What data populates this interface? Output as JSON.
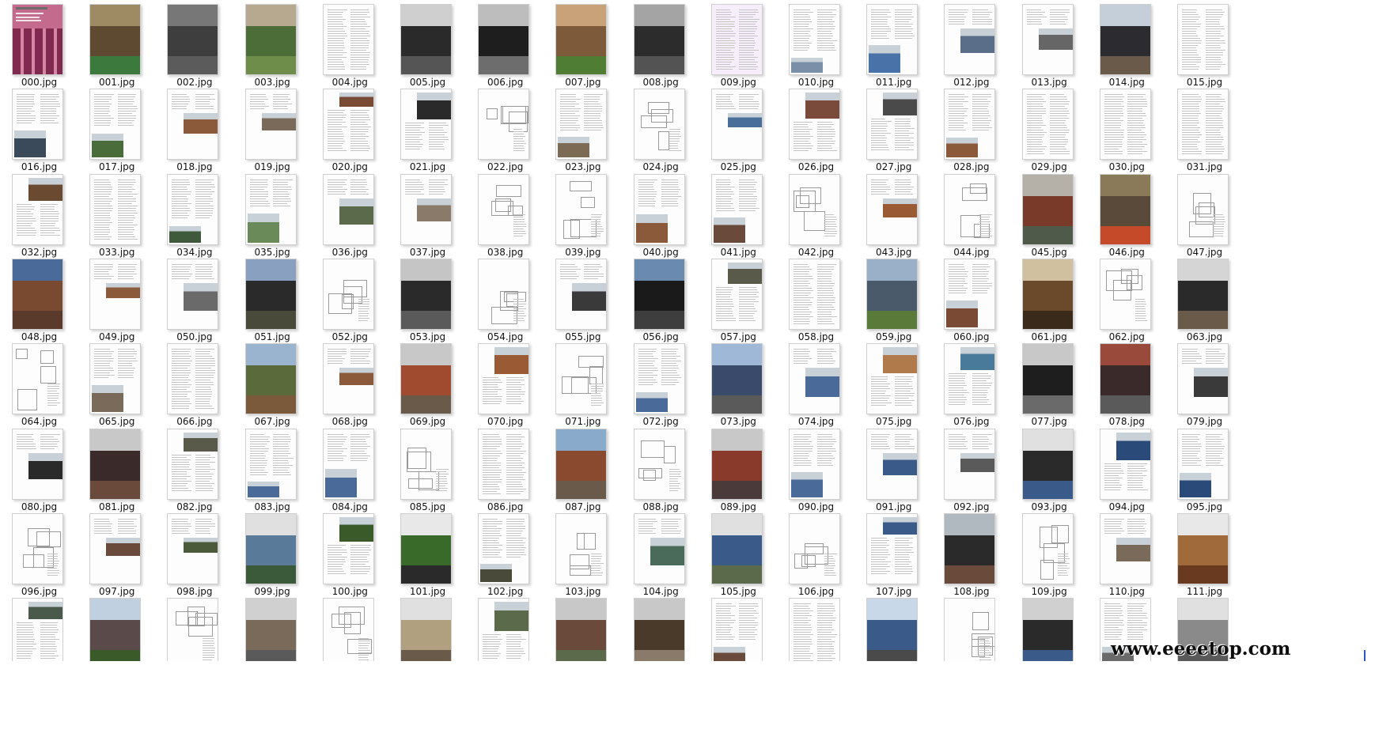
{
  "window": {
    "view": "large-icons",
    "watermark": "www.eeeetop.com"
  },
  "files": [
    {
      "name": "000.jpg",
      "kind": "cover"
    },
    {
      "name": "001.jpg",
      "kind": "photo",
      "colors": [
        "#5d4a30",
        "#9e8a63",
        "#3b7a3c"
      ]
    },
    {
      "name": "002.jpg",
      "kind": "photo",
      "colors": [
        "#3e3e3e",
        "#777777",
        "#5b5b5b"
      ]
    },
    {
      "name": "003.jpg",
      "kind": "photo",
      "colors": [
        "#4d6d38",
        "#b7a890",
        "#6e8c4a"
      ]
    },
    {
      "name": "004.jpg",
      "kind": "text"
    },
    {
      "name": "005.jpg",
      "kind": "photo",
      "colors": [
        "#2a2a2a",
        "#cfcfcf",
        "#555555"
      ]
    },
    {
      "name": "006.jpg",
      "kind": "photo",
      "colors": [
        "#1e1e1e",
        "#bdbdbd",
        "#6d6d6d"
      ]
    },
    {
      "name": "007.jpg",
      "kind": "photo",
      "colors": [
        "#7d5a3a",
        "#caa27a",
        "#4f7d34"
      ]
    },
    {
      "name": "008.jpg",
      "kind": "photo",
      "colors": [
        "#2c2c2c",
        "#a4a4a4",
        "#535353"
      ]
    },
    {
      "name": "009.jpg",
      "kind": "text",
      "tint": "#f6eefb"
    },
    {
      "name": "010.jpg",
      "kind": "mixed",
      "colors": [
        "#7b8fa8"
      ]
    },
    {
      "name": "011.jpg",
      "kind": "mixed",
      "colors": [
        "#4872a8"
      ]
    },
    {
      "name": "012.jpg",
      "kind": "mixed",
      "colors": [
        "#5a6e8a"
      ]
    },
    {
      "name": "013.jpg",
      "kind": "mixed",
      "colors": [
        "#666666"
      ]
    },
    {
      "name": "014.jpg",
      "kind": "photo",
      "colors": [
        "#2c2c30",
        "#c5cfd9",
        "#6a5a4a"
      ]
    },
    {
      "name": "015.jpg",
      "kind": "text"
    },
    {
      "name": "016.jpg",
      "kind": "mixed",
      "colors": [
        "#3b4a5a"
      ]
    },
    {
      "name": "017.jpg",
      "kind": "mixed",
      "colors": [
        "#4a6c3a"
      ]
    },
    {
      "name": "018.jpg",
      "kind": "mixed",
      "colors": [
        "#8a5a3a"
      ]
    },
    {
      "name": "019.jpg",
      "kind": "mixed",
      "colors": [
        "#7a6a5a"
      ]
    },
    {
      "name": "020.jpg",
      "kind": "mixed",
      "colors": [
        "#7a4a34"
      ]
    },
    {
      "name": "021.jpg",
      "kind": "mixed",
      "colors": [
        "#2a2a2a"
      ]
    },
    {
      "name": "022.jpg",
      "kind": "drawing"
    },
    {
      "name": "023.jpg",
      "kind": "mixed",
      "colors": [
        "#7d6a54"
      ]
    },
    {
      "name": "024.jpg",
      "kind": "drawing"
    },
    {
      "name": "025.jpg",
      "kind": "mixed",
      "colors": [
        "#4a6e9a"
      ]
    },
    {
      "name": "026.jpg",
      "kind": "mixed",
      "colors": [
        "#7a4a3a"
      ]
    },
    {
      "name": "027.jpg",
      "kind": "mixed",
      "colors": [
        "#4a4a4a"
      ]
    },
    {
      "name": "028.jpg",
      "kind": "mixed",
      "colors": [
        "#8a5a3a"
      ]
    },
    {
      "name": "029.jpg",
      "kind": "text"
    },
    {
      "name": "030.jpg",
      "kind": "text"
    },
    {
      "name": "031.jpg",
      "kind": "text"
    },
    {
      "name": "032.jpg",
      "kind": "mixed",
      "colors": [
        "#6a4a30"
      ]
    },
    {
      "name": "033.jpg",
      "kind": "text"
    },
    {
      "name": "034.jpg",
      "kind": "mixed",
      "colors": [
        "#3e5a3a"
      ]
    },
    {
      "name": "035.jpg",
      "kind": "mixed",
      "colors": [
        "#6a8a5a"
      ]
    },
    {
      "name": "036.jpg",
      "kind": "mixed",
      "colors": [
        "#5a6a4a"
      ]
    },
    {
      "name": "037.jpg",
      "kind": "mixed",
      "colors": [
        "#8a7a6a"
      ]
    },
    {
      "name": "038.jpg",
      "kind": "drawing"
    },
    {
      "name": "039.jpg",
      "kind": "drawing"
    },
    {
      "name": "040.jpg",
      "kind": "mixed",
      "colors": [
        "#8a5a3a"
      ]
    },
    {
      "name": "041.jpg",
      "kind": "mixed",
      "colors": [
        "#6a4a3a"
      ]
    },
    {
      "name": "042.jpg",
      "kind": "drawing"
    },
    {
      "name": "043.jpg",
      "kind": "mixed",
      "colors": [
        "#9a5a34"
      ]
    },
    {
      "name": "044.jpg",
      "kind": "drawing"
    },
    {
      "name": "045.jpg",
      "kind": "photo",
      "colors": [
        "#7a3a2a",
        "#b5b0a8",
        "#505a4a"
      ]
    },
    {
      "name": "046.jpg",
      "kind": "photo",
      "colors": [
        "#5a4a3a",
        "#8a7a5a",
        "#c44a2a"
      ]
    },
    {
      "name": "047.jpg",
      "kind": "drawing"
    },
    {
      "name": "048.jpg",
      "kind": "photo",
      "colors": [
        "#7a4a30",
        "#4a6a9a",
        "#5a3a2a"
      ]
    },
    {
      "name": "049.jpg",
      "kind": "mixed",
      "colors": [
        "#8a5a3a"
      ]
    },
    {
      "name": "050.jpg",
      "kind": "mixed",
      "colors": [
        "#6a6a6a"
      ]
    },
    {
      "name": "051.jpg",
      "kind": "photo",
      "colors": [
        "#2a2a2a",
        "#8aa0c0",
        "#4a4a3a"
      ]
    },
    {
      "name": "052.jpg",
      "kind": "drawing"
    },
    {
      "name": "053.jpg",
      "kind": "photo",
      "colors": [
        "#2a2a2a",
        "#c5c5c5",
        "#5a5a5a"
      ]
    },
    {
      "name": "054.jpg",
      "kind": "drawing"
    },
    {
      "name": "055.jpg",
      "kind": "mixed",
      "colors": [
        "#3a3a3a"
      ]
    },
    {
      "name": "056.jpg",
      "kind": "photo",
      "colors": [
        "#1a1a1a",
        "#6a8ab0",
        "#3e3e3e"
      ]
    },
    {
      "name": "057.jpg",
      "kind": "mixed",
      "colors": [
        "#5a5a4a"
      ]
    },
    {
      "name": "058.jpg",
      "kind": "text"
    },
    {
      "name": "059.jpg",
      "kind": "photo",
      "colors": [
        "#4a5a6a",
        "#9ab0c8",
        "#5a7a3a"
      ]
    },
    {
      "name": "060.jpg",
      "kind": "mixed",
      "colors": [
        "#7a4a34"
      ]
    },
    {
      "name": "061.jpg",
      "kind": "photo",
      "colors": [
        "#6a4a2a",
        "#d0c0a0",
        "#3a2a1a"
      ]
    },
    {
      "name": "062.jpg",
      "kind": "drawing"
    },
    {
      "name": "063.jpg",
      "kind": "photo",
      "colors": [
        "#2a2a2a",
        "#d5d5d5",
        "#6a5a4a"
      ]
    },
    {
      "name": "064.jpg",
      "kind": "drawing"
    },
    {
      "name": "065.jpg",
      "kind": "mixed",
      "colors": [
        "#7a6a5a"
      ]
    },
    {
      "name": "066.jpg",
      "kind": "text"
    },
    {
      "name": "067.jpg",
      "kind": "photo",
      "colors": [
        "#5a6a3a",
        "#9ab4d0",
        "#7a5a3a"
      ]
    },
    {
      "name": "068.jpg",
      "kind": "mixed",
      "colors": [
        "#8a5a3a"
      ]
    },
    {
      "name": "069.jpg",
      "kind": "photo",
      "colors": [
        "#a04a30",
        "#c8c8c8",
        "#6a5a4a"
      ]
    },
    {
      "name": "070.jpg",
      "kind": "mixed",
      "colors": [
        "#9a5a34"
      ]
    },
    {
      "name": "071.jpg",
      "kind": "drawing"
    },
    {
      "name": "072.jpg",
      "kind": "mixed",
      "colors": [
        "#4a6a9a"
      ]
    },
    {
      "name": "073.jpg",
      "kind": "photo",
      "colors": [
        "#3a4a6a",
        "#a0b8d8",
        "#5a5a5a"
      ]
    },
    {
      "name": "074.jpg",
      "kind": "mixed",
      "colors": [
        "#4a6a9a"
      ]
    },
    {
      "name": "075.jpg",
      "kind": "mixed",
      "colors": [
        "#b07a4a"
      ]
    },
    {
      "name": "076.jpg",
      "kind": "mixed",
      "colors": [
        "#4a7a9a"
      ]
    },
    {
      "name": "077.jpg",
      "kind": "photo",
      "colors": [
        "#1e1e1e",
        "#c8c8c8",
        "#6a6a6a"
      ]
    },
    {
      "name": "078.jpg",
      "kind": "photo",
      "colors": [
        "#3a2a2a",
        "#9a4a3a",
        "#5a5a5a"
      ]
    },
    {
      "name": "079.jpg",
      "kind": "mixed",
      "colors": [
        "#3a3a3a"
      ]
    },
    {
      "name": "080.jpg",
      "kind": "mixed",
      "colors": [
        "#2a2a2a"
      ]
    },
    {
      "name": "081.jpg",
      "kind": "photo",
      "colors": [
        "#3a2a2a",
        "#c8c8c8",
        "#6a4a3a"
      ]
    },
    {
      "name": "082.jpg",
      "kind": "mixed",
      "colors": [
        "#5a5a4a"
      ]
    },
    {
      "name": "083.jpg",
      "kind": "mixed",
      "colors": [
        "#4a6a9a"
      ]
    },
    {
      "name": "084.jpg",
      "kind": "mixed",
      "colors": [
        "#4a6a9a"
      ]
    },
    {
      "name": "085.jpg",
      "kind": "drawing"
    },
    {
      "name": "086.jpg",
      "kind": "text"
    },
    {
      "name": "087.jpg",
      "kind": "photo",
      "colors": [
        "#8a4a30",
        "#8aaacc",
        "#6a5a4a"
      ]
    },
    {
      "name": "088.jpg",
      "kind": "drawing"
    },
    {
      "name": "089.jpg",
      "kind": "photo",
      "colors": [
        "#8a3a2a",
        "#c8c8c8",
        "#4a3a3a"
      ]
    },
    {
      "name": "090.jpg",
      "kind": "mixed",
      "colors": [
        "#4a6a9a"
      ]
    },
    {
      "name": "091.jpg",
      "kind": "mixed",
      "colors": [
        "#3a5a8a"
      ]
    },
    {
      "name": "092.jpg",
      "kind": "mixed",
      "colors": [
        "#5a5a5a"
      ]
    },
    {
      "name": "093.jpg",
      "kind": "photo",
      "colors": [
        "#2a2a2a",
        "#e0e0e0",
        "#3a5a8a"
      ]
    },
    {
      "name": "094.jpg",
      "kind": "mixed",
      "colors": [
        "#2a4a7a"
      ]
    },
    {
      "name": "095.jpg",
      "kind": "mixed",
      "colors": [
        "#2a4a7a"
      ]
    },
    {
      "name": "096.jpg",
      "kind": "drawing"
    },
    {
      "name": "097.jpg",
      "kind": "mixed",
      "colors": [
        "#6a4a3a"
      ]
    },
    {
      "name": "098.jpg",
      "kind": "mixed",
      "colors": [
        "#4a5a3a"
      ]
    },
    {
      "name": "099.jpg",
      "kind": "photo",
      "colors": [
        "#5a7a9a",
        "#e0e0e0",
        "#3a5a3a"
      ]
    },
    {
      "name": "100.jpg",
      "kind": "mixed",
      "colors": [
        "#3a5a2a"
      ]
    },
    {
      "name": "101.jpg",
      "kind": "photo",
      "colors": [
        "#3a6a2a",
        "#e8e8e8",
        "#2a2a2a"
      ]
    },
    {
      "name": "102.jpg",
      "kind": "mixed",
      "colors": [
        "#4a4a3a"
      ]
    },
    {
      "name": "103.jpg",
      "kind": "drawing"
    },
    {
      "name": "104.jpg",
      "kind": "mixed",
      "colors": [
        "#4a6a5a"
      ]
    },
    {
      "name": "105.jpg",
      "kind": "photo",
      "colors": [
        "#3a5a8a",
        "#e0e0e0",
        "#5a6a4a"
      ]
    },
    {
      "name": "106.jpg",
      "kind": "drawing"
    },
    {
      "name": "107.jpg",
      "kind": "mixed",
      "colors": [
        "#3a5a8a"
      ]
    },
    {
      "name": "108.jpg",
      "kind": "photo",
      "colors": [
        "#2a2a2a",
        "#b0b8c0",
        "#6a4a3a"
      ]
    },
    {
      "name": "109.jpg",
      "kind": "drawing"
    },
    {
      "name": "110.jpg",
      "kind": "mixed",
      "colors": [
        "#7a6a5a"
      ]
    },
    {
      "name": "111.jpg",
      "kind": "photo",
      "colors": [
        "#a06a3a",
        "#e8e8e8",
        "#6a3a20"
      ]
    },
    {
      "name": "",
      "kind": "mixed",
      "colors": [
        "#4a5a4a"
      ]
    },
    {
      "name": "",
      "kind": "photo",
      "colors": [
        "#5a4a4a",
        "#c0d0e0",
        "#3a5a2a"
      ]
    },
    {
      "name": "",
      "kind": "drawing"
    },
    {
      "name": "",
      "kind": "photo",
      "colors": [
        "#7a6a5a",
        "#d0d0d0",
        "#5a5a5a"
      ]
    },
    {
      "name": "",
      "kind": "drawing"
    },
    {
      "name": "",
      "kind": "photo",
      "colors": [
        "#b0a080",
        "#e0e0e0",
        "#6a5a4a"
      ]
    },
    {
      "name": "",
      "kind": "mixed",
      "colors": [
        "#5a6a4a"
      ]
    },
    {
      "name": "",
      "kind": "photo",
      "colors": [
        "#6a4a3a",
        "#c8c8c8",
        "#5a6a4a"
      ]
    },
    {
      "name": "",
      "kind": "photo",
      "colors": [
        "#4a3a2a",
        "#c8c8c8",
        "#8a7a6a"
      ]
    },
    {
      "name": "",
      "kind": "mixed",
      "colors": [
        "#6a4a3a"
      ]
    },
    {
      "name": "",
      "kind": "text"
    },
    {
      "name": "",
      "kind": "photo",
      "colors": [
        "#3a5a8a",
        "#c8d8e8",
        "#4a4a4a"
      ]
    },
    {
      "name": "",
      "kind": "drawing"
    },
    {
      "name": "",
      "kind": "photo",
      "colors": [
        "#2a2a2a",
        "#d0d0d0",
        "#3a5a8a"
      ]
    },
    {
      "name": "",
      "kind": "mixed",
      "colors": [
        "#6a6a6a"
      ]
    },
    {
      "name": "",
      "kind": "photo",
      "colors": [
        "#8a8a8a",
        "#e0e0e0",
        "#5a5a5a"
      ]
    }
  ]
}
